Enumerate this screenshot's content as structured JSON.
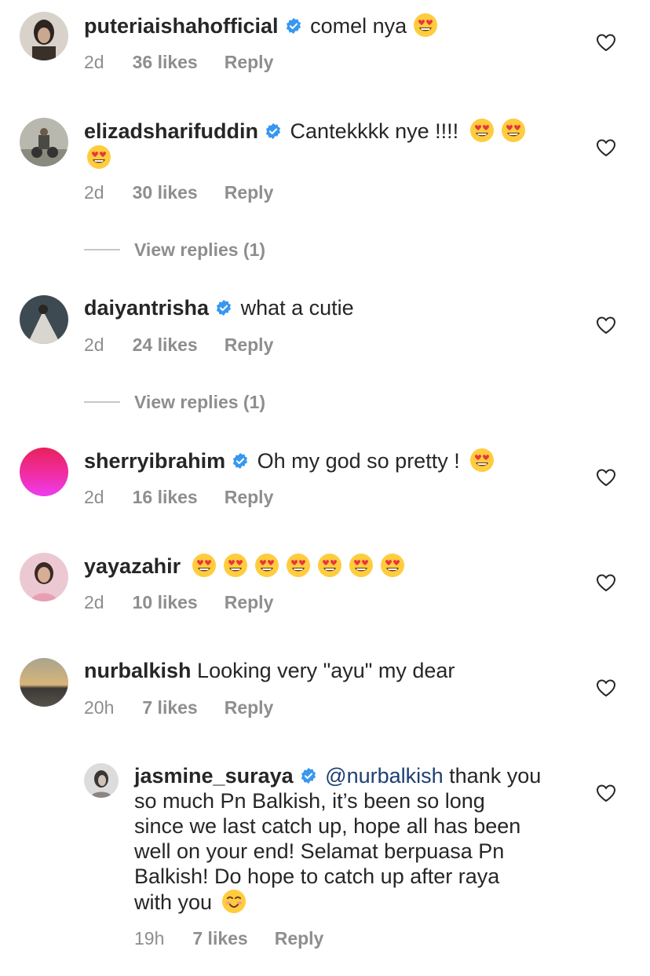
{
  "colors": {
    "text": "#262626",
    "meta": "#8e8e8e",
    "verified": "#3897f0",
    "mention": "#1d3f73",
    "heart": "#262626"
  },
  "comments": [
    {
      "username": "puteriaishahofficial",
      "verified": true,
      "text": "comel nya",
      "emoji_count": 1,
      "time": "2d",
      "likes": "36 likes",
      "reply": "Reply"
    },
    {
      "username": "elizadsharifuddin",
      "verified": true,
      "text": "Cantekkkk nye !!!!",
      "emoji_count": 3,
      "time": "2d",
      "likes": "30 likes",
      "reply": "Reply",
      "view_replies": "View replies (1)"
    },
    {
      "username": "daiyantrisha",
      "verified": true,
      "text": "what a cutie",
      "emoji_count": 0,
      "time": "2d",
      "likes": "24 likes",
      "reply": "Reply",
      "view_replies": "View replies (1)"
    },
    {
      "username": "sherryibrahim",
      "verified": true,
      "text": "Oh my god so pretty !",
      "emoji_count": 1,
      "time": "2d",
      "likes": "16 likes",
      "reply": "Reply"
    },
    {
      "username": "yayazahir",
      "verified": false,
      "text": "",
      "emoji_count": 7,
      "time": "2d",
      "likes": "10 likes",
      "reply": "Reply"
    },
    {
      "username": "nurbalkish",
      "verified": false,
      "text": "Looking very \"ayu\" my dear",
      "emoji_count": 0,
      "time": "20h",
      "likes": "7 likes",
      "reply": "Reply"
    }
  ],
  "reply": {
    "username": "jasmine_suraya",
    "verified": true,
    "mention": "@nurbalkish",
    "line1": "thank you",
    "line2": "so much Pn Balkish, it’s been so long",
    "line3": "since we last catch up, hope all has been",
    "line4": "well on your end! Selamat berpuasa Pn",
    "line5": "Balkish! Do hope to catch up after raya",
    "line6": "with you",
    "emoji": "smiling-face-icon",
    "time": "19h",
    "likes": "7 likes",
    "reply": "Reply"
  }
}
